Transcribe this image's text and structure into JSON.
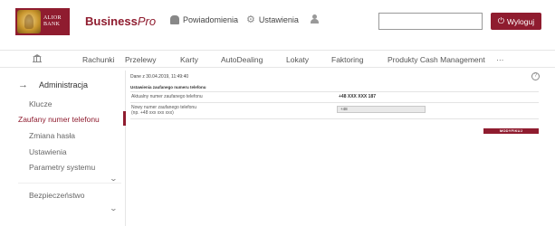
{
  "brand": {
    "logo_text_line1": "ALIOR",
    "logo_text_line2": "BANK",
    "name": "Business",
    "suffix": "Pro"
  },
  "header": {
    "notifications_label": "Powiadomienia",
    "settings_label": "Ustawienia",
    "search_value": "",
    "logout_label": "Wyloguj",
    "icons": {
      "notifications": "bell-icon",
      "settings": "gear-icon",
      "profile": "user-icon",
      "logout": "power-icon"
    }
  },
  "nav": {
    "home_icon": "bank-building-icon",
    "items": [
      {
        "label": "Rachunki"
      },
      {
        "label": "Przelewy"
      },
      {
        "label": "Karty"
      },
      {
        "label": "AutoDealing"
      },
      {
        "label": "Lokaty"
      },
      {
        "label": "Faktoring"
      },
      {
        "label": "Produkty Cash Management"
      },
      {
        "label": "···"
      }
    ]
  },
  "sidebar": {
    "heading": "Administracja",
    "items": [
      {
        "label": "Klucze",
        "active": false
      },
      {
        "label": "Zaufany numer telefonu",
        "active": true
      },
      {
        "label": "Zmiana hasła",
        "active": false
      },
      {
        "label": "Ustawienia",
        "active": false
      },
      {
        "label": "Parametry systemu",
        "active": false
      }
    ],
    "section2": "Bezpieczeństwo"
  },
  "panel": {
    "date": "Dane z 30.04.2019, 11:49:40",
    "title": "Ustawienia zaufanego numeru telefonu",
    "current_label": "Aktualny numer zaufanego telefonu",
    "current_value": "+48 XXX XXX 187",
    "new_label_line1": "Nowy numer zaufanego telefonu",
    "new_label_line2": "(np. +48 xxx xxx xxx)",
    "new_value": "+48",
    "modify_label": "MODYFIKUJ"
  },
  "colors": {
    "brand": "#8f1c2f"
  }
}
